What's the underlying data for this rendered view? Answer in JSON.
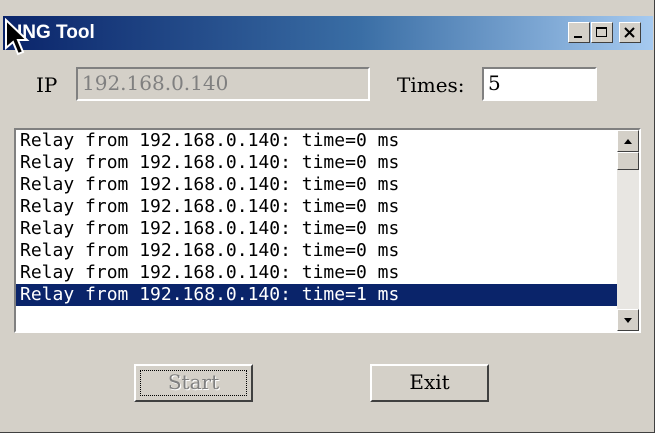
{
  "window": {
    "title": "ING Tool"
  },
  "controls": {
    "ip_label": "IP",
    "ip_value": "192.168.0.140",
    "times_label": "Times:",
    "times_value": "5"
  },
  "results": [
    "Relay from 192.168.0.140: time=0 ms",
    "Relay from 192.168.0.140: time=0 ms",
    "Relay from 192.168.0.140: time=0 ms",
    "Relay from 192.168.0.140: time=0 ms",
    "Relay from 192.168.0.140: time=0 ms",
    "Relay from 192.168.0.140: time=0 ms",
    "Relay from 192.168.0.140: time=0 ms",
    "Relay from 192.168.0.140: time=1 ms"
  ],
  "selected_index": 7,
  "buttons": {
    "start_label": "Start",
    "exit_label": "Exit"
  }
}
